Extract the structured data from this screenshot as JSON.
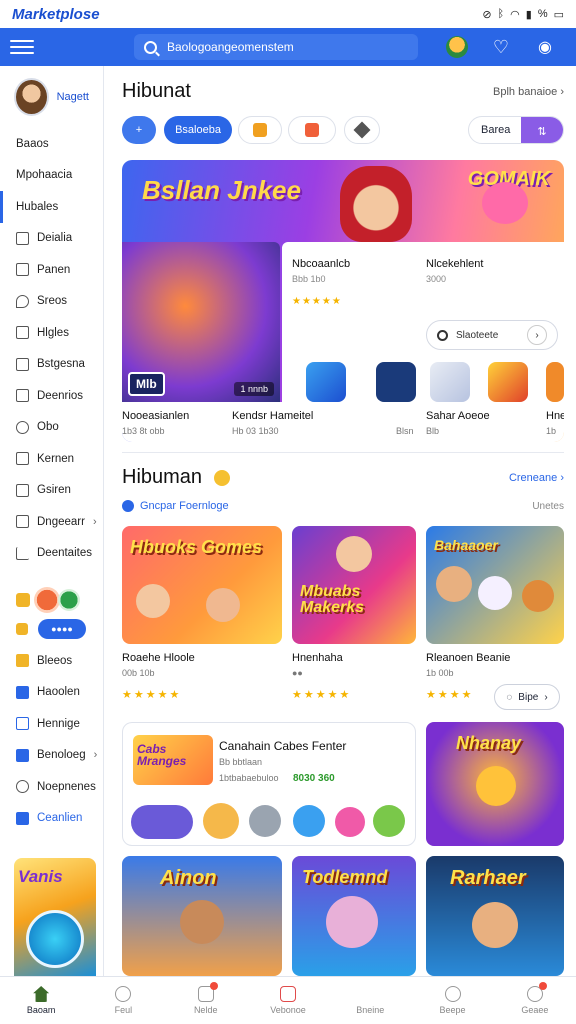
{
  "status": {
    "app_logo": "Marketplose",
    "icons": [
      "silent-icon",
      "bluetooth-icon",
      "wifi-icon",
      "signal-icon",
      "battery-icon"
    ],
    "battery": "%"
  },
  "topbar": {
    "search_placeholder": "Baologoangeomenstem"
  },
  "sidebar": {
    "user_name": "Nagett",
    "items": [
      {
        "label": "Baaos",
        "icon": ""
      },
      {
        "label": "Mpohaacia",
        "icon": ""
      },
      {
        "label": "Hubales",
        "icon": ""
      },
      {
        "label": "Deialia",
        "icon": "grid-icon"
      },
      {
        "label": "Panen",
        "icon": "layers-icon"
      },
      {
        "label": "Sreos",
        "icon": "tag-icon"
      },
      {
        "label": "Hlgles",
        "icon": "chart-icon"
      },
      {
        "label": "Bstgesna",
        "icon": "edit-icon"
      },
      {
        "label": "Deenrios",
        "icon": "book-icon"
      },
      {
        "label": "Obo",
        "icon": "circle-icon"
      },
      {
        "label": "Kernen",
        "icon": "box-icon"
      },
      {
        "label": "Gsiren",
        "icon": "image-icon"
      },
      {
        "label": "Dngeearr",
        "icon": "list-icon"
      },
      {
        "label": "Deentaites",
        "icon": "share-icon"
      }
    ],
    "pill": "",
    "items2": [
      {
        "label": "Bleeos",
        "color": "#f0b428"
      },
      {
        "label": "Haoolen",
        "color": "#2a66e6"
      },
      {
        "label": "Hennige",
        "color": "#2a66e6"
      },
      {
        "label": "Benoloeg",
        "color": "#2a66e6"
      },
      {
        "label": "Noepnenes",
        "color": "#555"
      },
      {
        "label": "Ceanlien",
        "color": "#2a66e6"
      }
    ],
    "banner_title": "Vanis"
  },
  "main": {
    "section1_title": "Hibunat",
    "section1_more": "Bplh banaioe",
    "filter_chip_active": "Bsaloeba",
    "sort_label": "Barea",
    "hero": {
      "title": "Bsllan Jnkee",
      "right_title": "GOMAIK",
      "game_tag": "Mlb",
      "game_tag2": "1 nnnb",
      "card_left_title": "Nbcoaanlcb",
      "card_left_meta": "Bbb 1b0",
      "card_right_title": "Nlcekehlent",
      "card_right_meta": "3000",
      "search_text": "Slaoteete",
      "foot_left_title": "Nooeasianlen",
      "foot_left_meta": "1b3 8t obb",
      "foot_mid_title": "Kendsr Hameitel",
      "foot_mid_meta": "Hb 03 1b30",
      "foot_mid_extra": "Blsn",
      "foot_right_title": "Sahar Aoeoe",
      "foot_right_meta": "Blb",
      "foot_far_title": "Hne",
      "foot_far_meta": "1b"
    },
    "section2_title": "Hibuman",
    "section2_more": "Creneane",
    "section2_sub": "Gncpar Foernloge",
    "section2_sub_right": "Unetes",
    "games": [
      {
        "art": "Hbuoks Gomes",
        "name": "Roaehe Hloole",
        "meta": "00b 10b"
      },
      {
        "art": "Mbuabs Makerks",
        "name": "Hnenhaha",
        "meta": ""
      },
      {
        "art": "Bahaaoer",
        "name": "Rleanoen Beanie",
        "meta": "1b 00b"
      }
    ],
    "games_button": "Bipe",
    "combo": {
      "art": "Cabs Mranges",
      "title": "Canahain Cabes Fenter",
      "meta1": "Bb bbtlaan",
      "meta2": "1btbabaebuloo",
      "price": "8030 360"
    },
    "bottom_games": [
      {
        "art": "Nhanay"
      },
      {
        "art": "Ainon"
      },
      {
        "art": "Todlemnd"
      },
      {
        "art": "Rarhaer"
      }
    ]
  },
  "tabs": [
    {
      "label": "Baoam",
      "icon": "home-icon"
    },
    {
      "label": "Feul",
      "icon": "user-icon"
    },
    {
      "label": "Nelde",
      "icon": "bag-icon"
    },
    {
      "label": "Vebonoe",
      "icon": "gift-icon"
    },
    {
      "label": "Bneine",
      "icon": "blank-icon"
    },
    {
      "label": "Beepe",
      "icon": "clock-icon"
    },
    {
      "label": "Geaee",
      "icon": "profile-icon"
    }
  ],
  "colors": {
    "accent": "#2a66e6",
    "star": "#f5b400",
    "price": "#2c9a2c"
  }
}
